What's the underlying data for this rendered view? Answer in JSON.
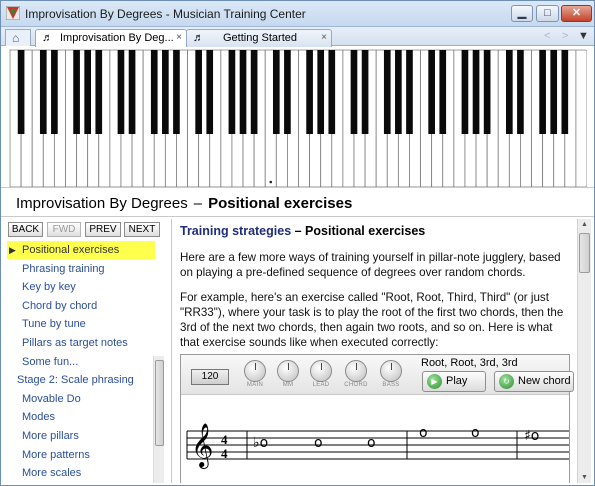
{
  "window": {
    "title": "Improvisation By Degrees - Musician Training Center",
    "minimize": "▁",
    "maximize": "□",
    "close": "✕"
  },
  "tabs": [
    {
      "label": "Improvisation By Deg...",
      "close": "×"
    },
    {
      "label": "Getting Started",
      "close": "×"
    }
  ],
  "tab_nav": {
    "left": "<",
    "right": ">",
    "menu": "▼"
  },
  "header": {
    "title": "Improvisation By Degrees",
    "dash": "–",
    "subtitle": "Positional exercises"
  },
  "nav_buttons": {
    "back": "BACK",
    "fwd": "FWD",
    "prev": "PREV",
    "next": "NEXT"
  },
  "nav_items": [
    {
      "label": "Positional exercises",
      "selected": true,
      "arrow": "▶"
    },
    {
      "label": "Phrasing training"
    },
    {
      "label": "Key by key"
    },
    {
      "label": "Chord by chord"
    },
    {
      "label": "Tune by tune"
    },
    {
      "label": "Pillars as target notes"
    },
    {
      "label": "Some fun..."
    },
    {
      "label": "Stage 2: Scale phrasing",
      "stage": true
    },
    {
      "label": "Movable Do"
    },
    {
      "label": "Modes"
    },
    {
      "label": "More pillars"
    },
    {
      "label": "More patterns"
    },
    {
      "label": "More scales"
    }
  ],
  "content": {
    "title_link": "Training strategies",
    "title_rest": " – Positional exercises",
    "para1": "Here are a few more ways of training yourself in pillar-note jugglery, based on playing a pre-defined sequence of degrees over random chords.",
    "para2": "For example, here's an exercise called \"Root, Root, Third, Third\" (or just \"RR33\"), where your task is to play the root of the first two chords, then the 3rd of the next two chords, then again two roots, and so on. Here is what that exercise sounds like when executed correctly:"
  },
  "player": {
    "tempo": "120",
    "knobs": [
      "MAIN",
      "MM",
      "LEAD",
      "CHORD",
      "BASS"
    ],
    "exercise_name": "Root, Root, 3rd, 3rd",
    "play_label": "Play",
    "new_chord_label": "New chord"
  },
  "staff": {
    "time_top": "4",
    "time_bottom": "4",
    "notes": [
      "♭o",
      "o",
      "o",
      "o",
      "o",
      "♯o"
    ]
  },
  "colors": {
    "selected_bg": "#ffff4d",
    "link": "#1f2d7a",
    "nav_text": "#2b4f9a",
    "titlebar": "#c6d9ef"
  }
}
